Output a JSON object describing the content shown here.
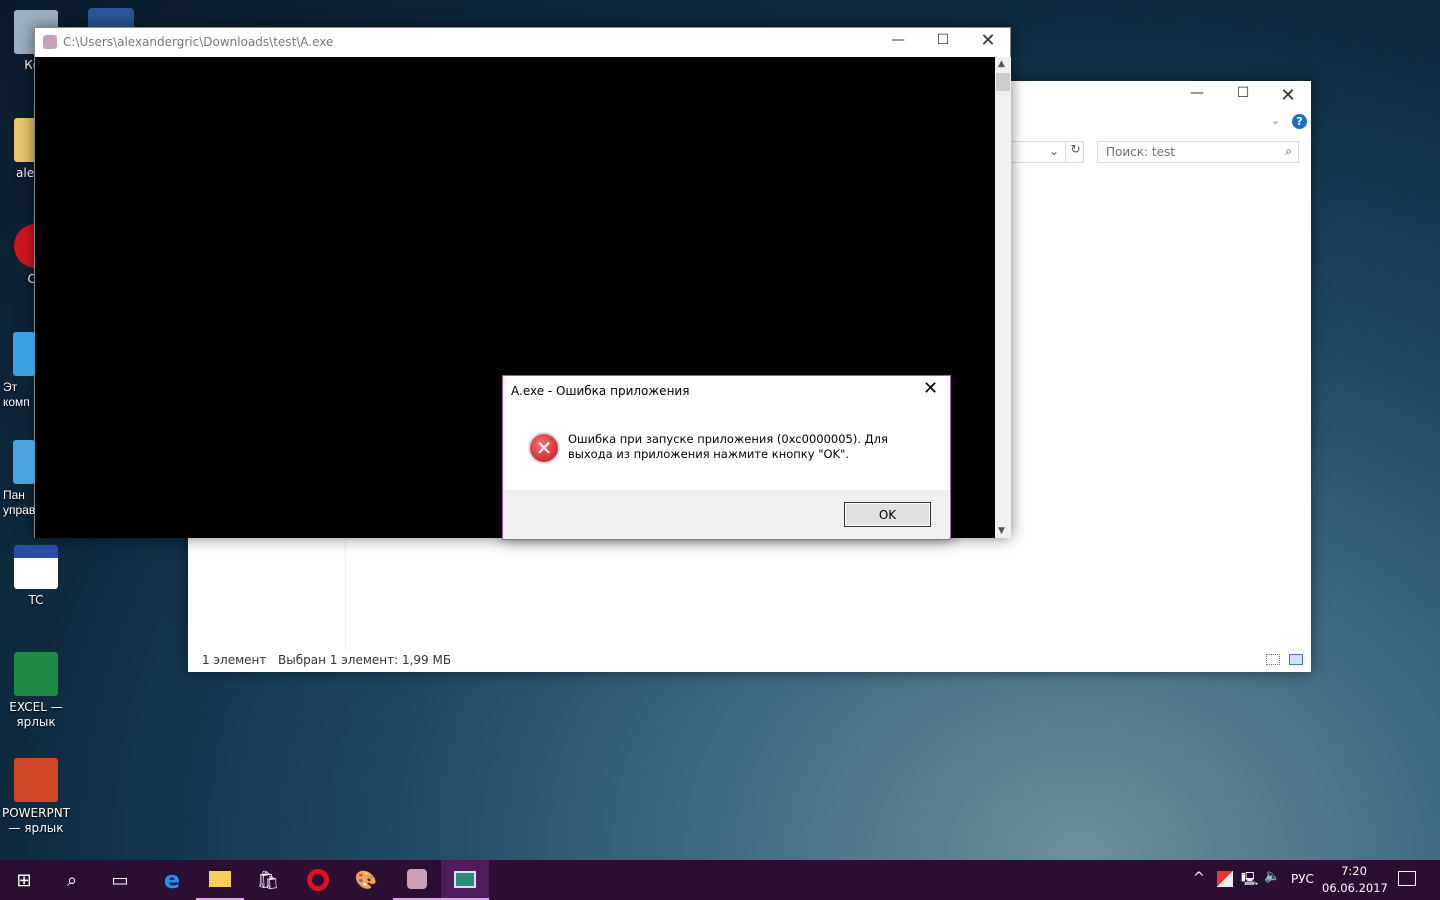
{
  "desktop": {
    "icons": [
      {
        "label": "Кор"
      },
      {
        "label": "alexan"
      },
      {
        "label": "Op"
      },
      {
        "label": "Эт\nкомп"
      },
      {
        "label": "Пан\nуправ"
      },
      {
        "label": "TC"
      },
      {
        "label": "EXCEL —\nярлык"
      },
      {
        "label": "POWERPNT\n— ярлык"
      }
    ]
  },
  "explorer": {
    "search_placeholder": "Поиск: test",
    "status_count": "1 элемент",
    "status_selected": "Выбран 1 элемент: 1,99 МБ"
  },
  "console": {
    "title": "C:\\Users\\alexandergric\\Downloads\\test\\A.exe"
  },
  "dialog": {
    "title": "A.exe - Ошибка приложения",
    "message": "Ошибка при запуске приложения (0xc0000005). Для выхода из приложения нажмите кнопку \"OK\".",
    "ok_label": "OK",
    "icon": "error-icon"
  },
  "taskbar": {
    "language": "РУС",
    "time": "7:20",
    "date": "06.06.2017",
    "color": "#2a0f33"
  }
}
